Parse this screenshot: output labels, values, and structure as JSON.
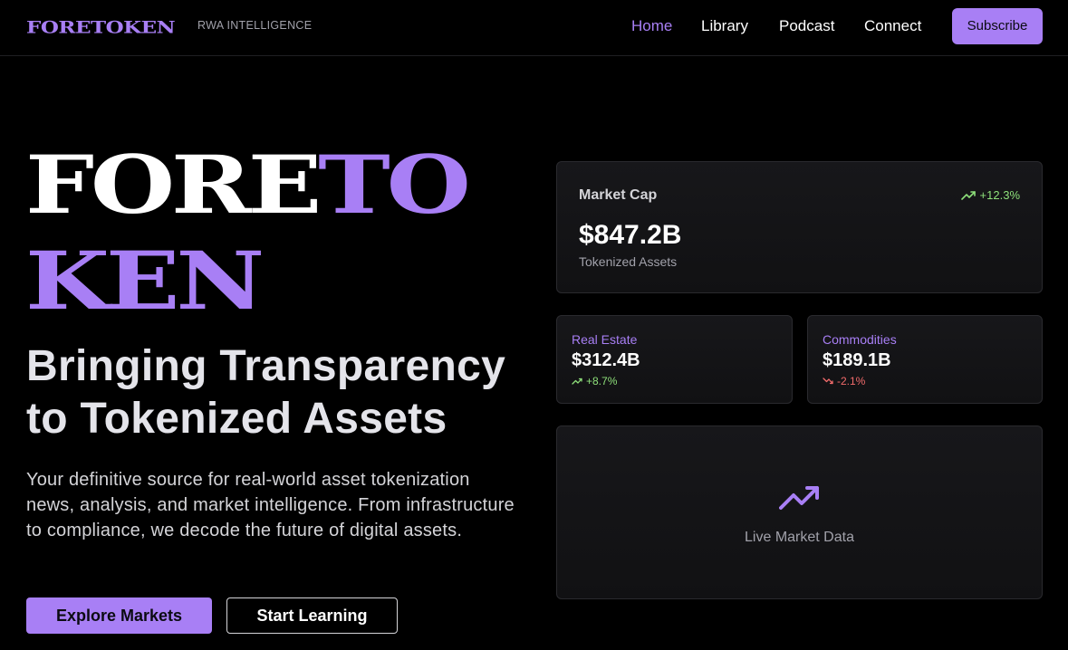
{
  "brand": {
    "logo": "FORETOKEN",
    "tagline": "RWA INTELLIGENCE"
  },
  "nav": {
    "links": [
      "Home",
      "Library",
      "Podcast",
      "Connect"
    ],
    "active": "Home",
    "subscribe_label": "Subscribe"
  },
  "hero": {
    "big_line1_white": "FORE",
    "big_line1_purple": "TO",
    "big_line2": "KEN",
    "headline_line1": "Bringing Transparency",
    "headline_line2": "to Tokenized Assets",
    "description": "Your definitive source for real-world asset tokenization news, analysis, and market intelligence. From infrastructure to compliance, we decode the future of digital assets.",
    "primary_button": "Explore Markets",
    "secondary_button": "Start Learning"
  },
  "market": {
    "main": {
      "label": "Market Cap",
      "change": "+12.3%",
      "value": "$847.2B",
      "sub": "Tokenized Assets"
    },
    "real_estate": {
      "label": "Real Estate",
      "value": "$312.4B",
      "change": "+8.7%"
    },
    "commodities": {
      "label": "Commodities",
      "value": "$189.1B",
      "change": "-2.1%"
    },
    "live_label": "Live Market Data"
  },
  "colors": {
    "accent": "#a87ff5",
    "background": "#000000",
    "positive": "#8ee07a",
    "negative": "#f26b6b"
  },
  "icons": {
    "trend_up": "trending-up-icon",
    "trend_down": "trending-down-icon"
  }
}
